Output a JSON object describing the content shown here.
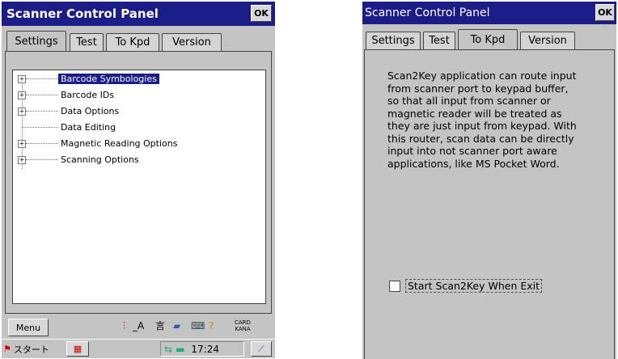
{
  "left": {
    "title": "Scanner Control Panel",
    "ok": "OK",
    "tabs": [
      "Settings",
      "Test",
      "To Kpd",
      "Version"
    ],
    "active_tab": "Settings",
    "tree": [
      {
        "label": "Barcode Symbologies",
        "expandable": true,
        "selected": true
      },
      {
        "label": "Barcode IDs",
        "expandable": true,
        "selected": false
      },
      {
        "label": "Data Options",
        "expandable": true,
        "selected": false
      },
      {
        "label": "Data Editing",
        "expandable": false,
        "selected": false
      },
      {
        "label": "Magnetic Reading Options",
        "expandable": true,
        "selected": false
      },
      {
        "label": "Scanning Options",
        "expandable": true,
        "selected": false
      }
    ],
    "menu_button": "Menu",
    "tray": {
      "font_label": "A",
      "card_label_1": "CARD",
      "card_label_2": "KANA"
    },
    "taskbar": {
      "start_label": "スタート",
      "time": "17:24"
    }
  },
  "right": {
    "title": "Scanner Control Panel",
    "ok": "OK",
    "tabs": [
      "Settings",
      "Test",
      "To Kpd",
      "Version"
    ],
    "active_tab": "To Kpd",
    "description": "Scan2Key application can route input from scanner port to keypad buffer, so that all input from scanner or magnetic reader will be treated as they are just input from keypad. With this router, scan data can be directly input into not scanner port aware applications, like MS Pocket Word.",
    "checkbox_label": "Start Scan2Key When Exit",
    "checkbox_checked": false
  },
  "colors": {
    "titlebar": "#1c1c86",
    "window": "#c4c4c4",
    "selection": "#1c1c86"
  }
}
